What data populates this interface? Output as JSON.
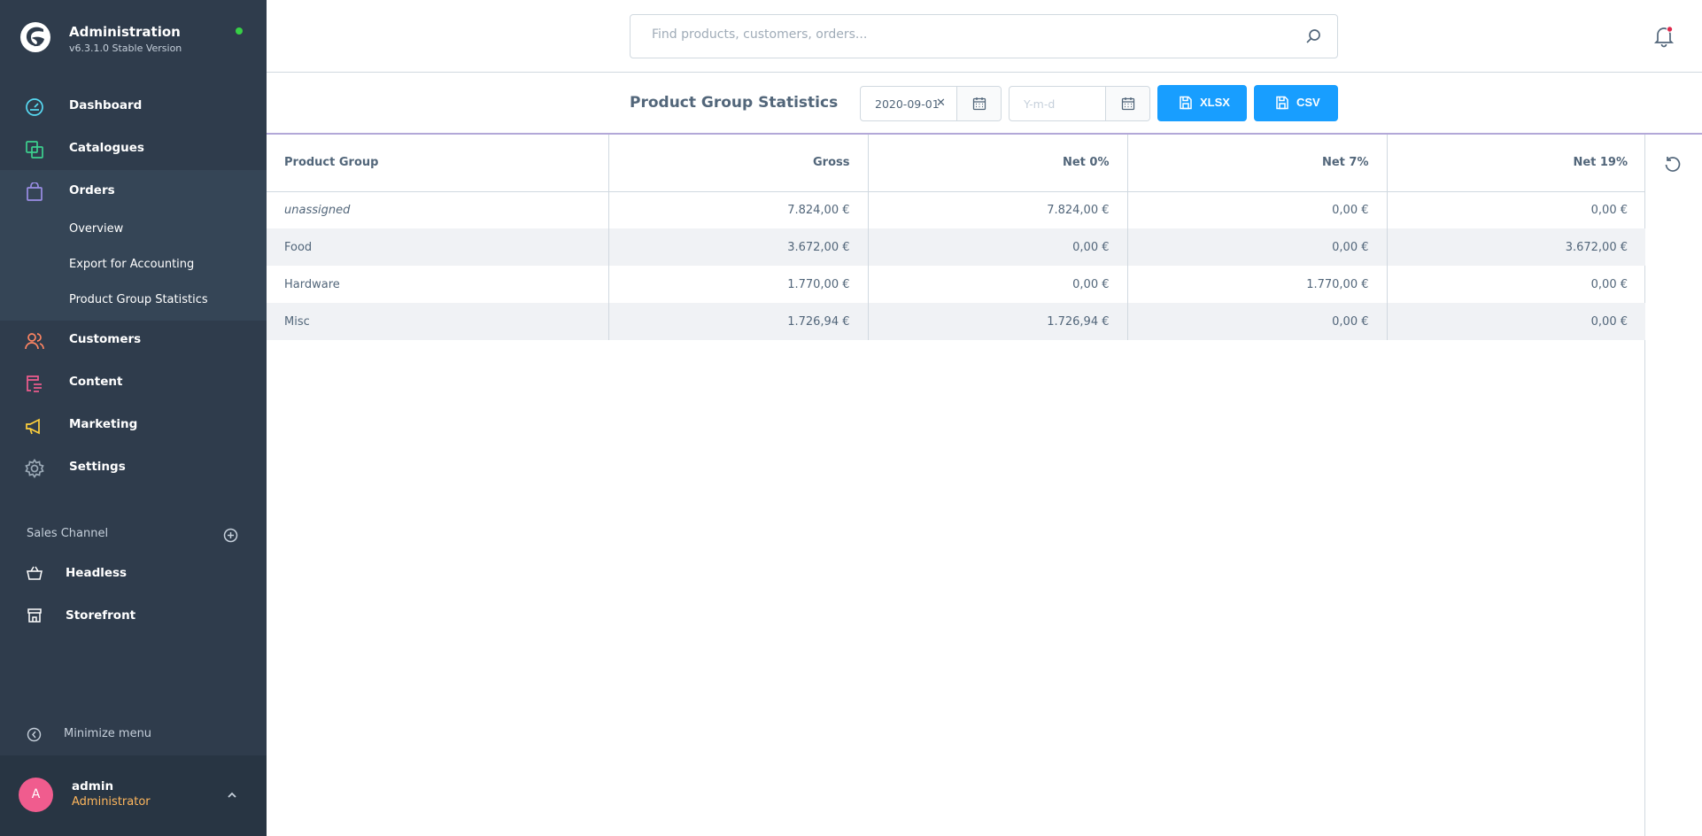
{
  "app": {
    "title": "Administration",
    "version": "v6.3.1.0 Stable Version",
    "status_color": "#37d046"
  },
  "sidebar": {
    "nav": [
      {
        "label": "Dashboard",
        "icon": "dashboard-icon",
        "color": "#57d9f2"
      },
      {
        "label": "Catalogues",
        "icon": "catalogue-icon",
        "color": "#3cd08e"
      },
      {
        "label": "Orders",
        "icon": "orders-icon",
        "color": "#9b8ee6"
      },
      {
        "label": "Customers",
        "icon": "customers-icon",
        "color": "#ff8562"
      },
      {
        "label": "Content",
        "icon": "content-icon",
        "color": "#f05c8e"
      },
      {
        "label": "Marketing",
        "icon": "marketing-icon",
        "color": "#ffd03c"
      },
      {
        "label": "Settings",
        "icon": "settings-icon",
        "color": "#9aa8b5"
      }
    ],
    "orders_sub": [
      {
        "label": "Overview"
      },
      {
        "label": "Export for Accounting"
      },
      {
        "label": "Product Group Statistics"
      }
    ],
    "sales_channel_title": "Sales Channel",
    "sales_channels": [
      {
        "label": "Headless",
        "icon": "basket-icon"
      },
      {
        "label": "Storefront",
        "icon": "storefront-icon"
      }
    ],
    "minimize_label": "Minimize menu"
  },
  "user": {
    "initial": "A",
    "name": "admin",
    "role": "Administrator"
  },
  "search": {
    "placeholder": "Find products, customers, orders..."
  },
  "toolbar": {
    "title": "Product Group Statistics",
    "date_from": "2020-09-01",
    "date_to_placeholder": "Y-m-d",
    "xlsx_label": "XLSX",
    "csv_label": "CSV"
  },
  "table": {
    "columns": [
      "Product Group",
      "Gross",
      "Net 0%",
      "Net 7%",
      "Net 19%"
    ],
    "rows": [
      [
        "unassigned",
        "7.824,00 €",
        "7.824,00 €",
        "0,00 €",
        "0,00 €"
      ],
      [
        "Food",
        "3.672,00 €",
        "0,00 €",
        "0,00 €",
        "3.672,00 €"
      ],
      [
        "Hardware",
        "1.770,00 €",
        "0,00 €",
        "1.770,00 €",
        "0,00 €"
      ],
      [
        "Misc",
        "1.726,94 €",
        "1.726,94 €",
        "0,00 €",
        "0,00 €"
      ]
    ]
  },
  "colors": {
    "sidebar_bg": "#2f3c4c",
    "primary_button": "#189eff",
    "role_text": "#ffb75d",
    "avatar_bg": "#f05c8e",
    "notification_dot": "#de294c"
  }
}
